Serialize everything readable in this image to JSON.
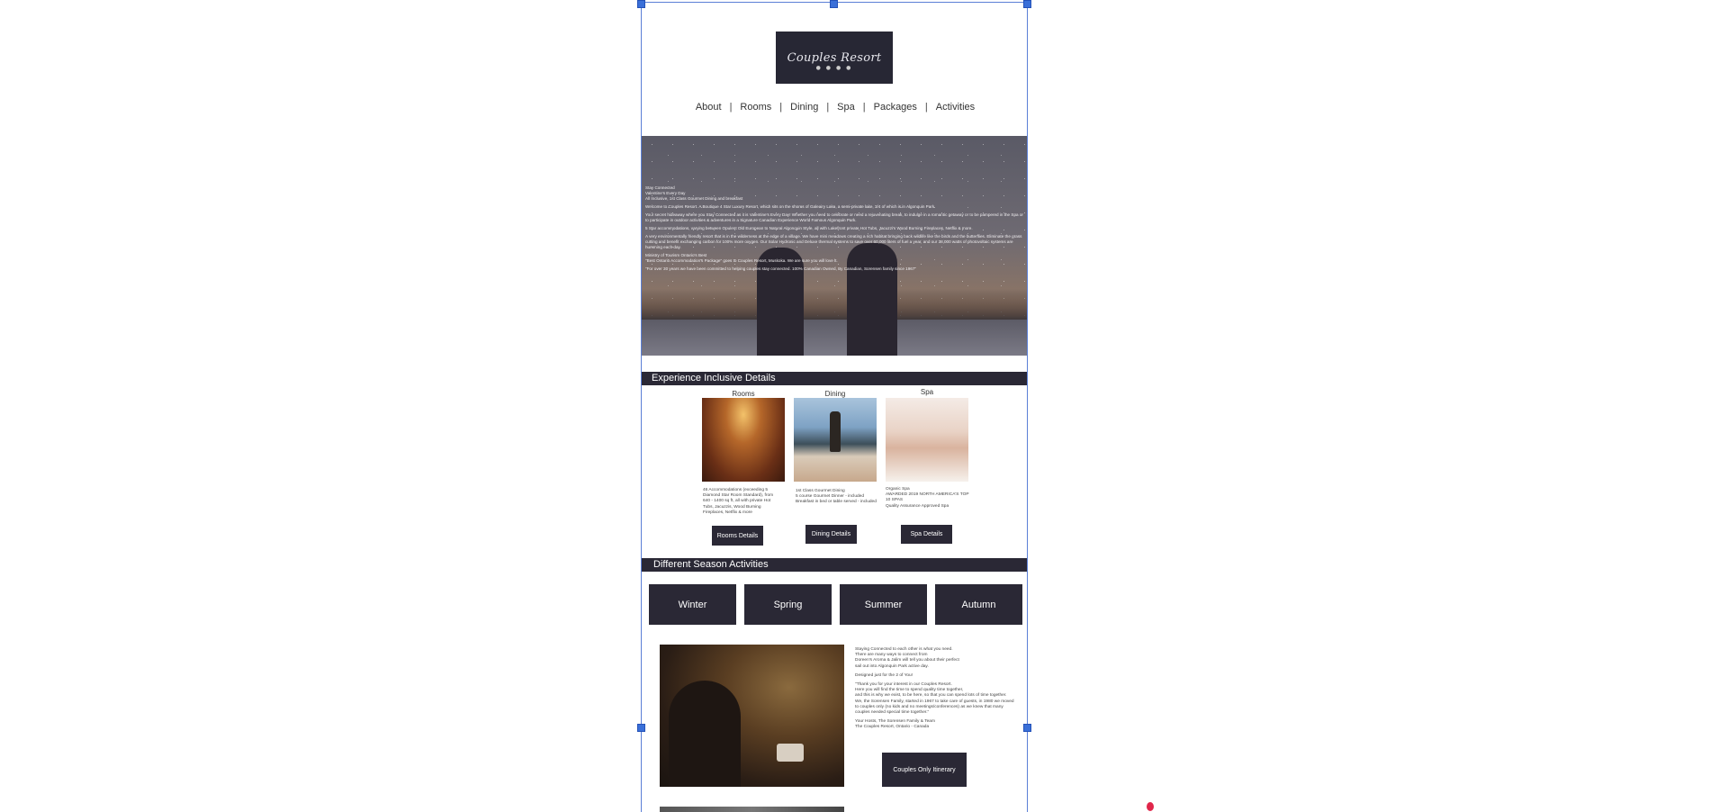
{
  "logo": {
    "text": "Couples Resort",
    "dots": "● ● ● ●"
  },
  "nav": {
    "items": [
      "About",
      "Rooms",
      "Dining",
      "Spa",
      "Packages",
      "Activities"
    ],
    "separator": "|"
  },
  "hero": {
    "paragraphs": [
      "Stay Connected\nValentine's Every Day\nAll Inclusive, 1st Class Gourmet Dining and breakfast",
      "Welcome to Couples Resort.  A Boutique 4 Star Luxury Resort, which sits on the shores of Galeairy Lake, a semi-private lake, 3/4 of which is in Algonquin Park.",
      "Your secret hideaway where you Stay Connected as it is Valentine's Every Day!  Whether you need to celebrate or need a rejuvenating break, to indulge in a romantic getaway or to be pampered in the Spa or to participate in outdoor activities & adventures in a Signature Canadian Experience World Famous Algonquin Park.",
      "5 Star accommodations, varying between Opulent Old European to Natural Algonquin Style, all with Lakefront private Hot Tubs, Jacuzzi's Wood Burning Fireplaces, Netflix & more.",
      "A very environmentally friendly resort that is in the wilderness at the edge of a village.  We have mini meadows creating a rich habitat bringing back wildlife like the birds and the butterflies. Eliminate the grass cutting and benefit exchanging carbon for 100% more oxygen.  Our Solar Hydronic and Deluxe thermal systems to save over 60,000 liters of fuel a year, and our 38,000 watts of photovoltaic systems are humming each day.",
      "Ministry of Tourism Ontario's Best\n\"Best Ontario Accommodation's Package\" goes to Couples Resort, Muskoka. We are sure you will love it.",
      "\"For over 30 years we have been committed to helping couples stay connected. 100% Canadian Owned, By Canadian, Sorensen family since 1967\""
    ]
  },
  "inclusive": {
    "heading": "Experience Inclusive Details",
    "columns": [
      {
        "label": "Rooms",
        "text": "46 Accommodations (exceeding 5\nDiamond Star Room Standard), from\n640 - 1400 sq ft, all with private Hot\nTubs, Jacuzzis, Wood Burning\nFireplaces, Netflix & more",
        "button": "Rooms Details"
      },
      {
        "label": "Dining",
        "text": "1st Class Gourmet Dining\n5 course Gourmet Dinner - included\nBreakfast in bed or table served - included",
        "button": "Dining Details"
      },
      {
        "label": "Spa",
        "text": "Organic Spa\nAWARDED 2019 NORTH AMERICA'S TOP\n 10 SPAS\nQuality Assurance Approved Spa",
        "button": "Spa Details"
      }
    ]
  },
  "seasons": {
    "heading": "Different Season Activities",
    "items": [
      "Winter",
      "Spring",
      "Summer",
      "Autumn"
    ]
  },
  "story": {
    "paragraphs": [
      "Staying Connected to each other is what you need.\nThere are many ways to connect from\nDoreen's Aroma & Jalim will tell you about their perfect\nsail out into Algonquin Park active day.",
      "Designed just for the 2 of You!",
      "\"Thank you for your interest in our Couples Resort.\nHere you will find the time to spend quality time together,\nand this is why we exist, to be here, so that you can spend lots of time together.\nWe, the Sorensen Family, started in 1967 to take care of guests, in 1980 we moved\nto couples only (no kids and no meetings/conferences) as we knew that many\ncouples needed special time together.\"",
      "Your Hosts, The Sorensen Family & Team\nThe Couples Resort, Ontario - Canada"
    ],
    "button": "Couples Only Itinerary"
  },
  "colors": {
    "dark": "#2a2835",
    "selection": "#3a6fd8",
    "cursor": "#e0264a"
  }
}
